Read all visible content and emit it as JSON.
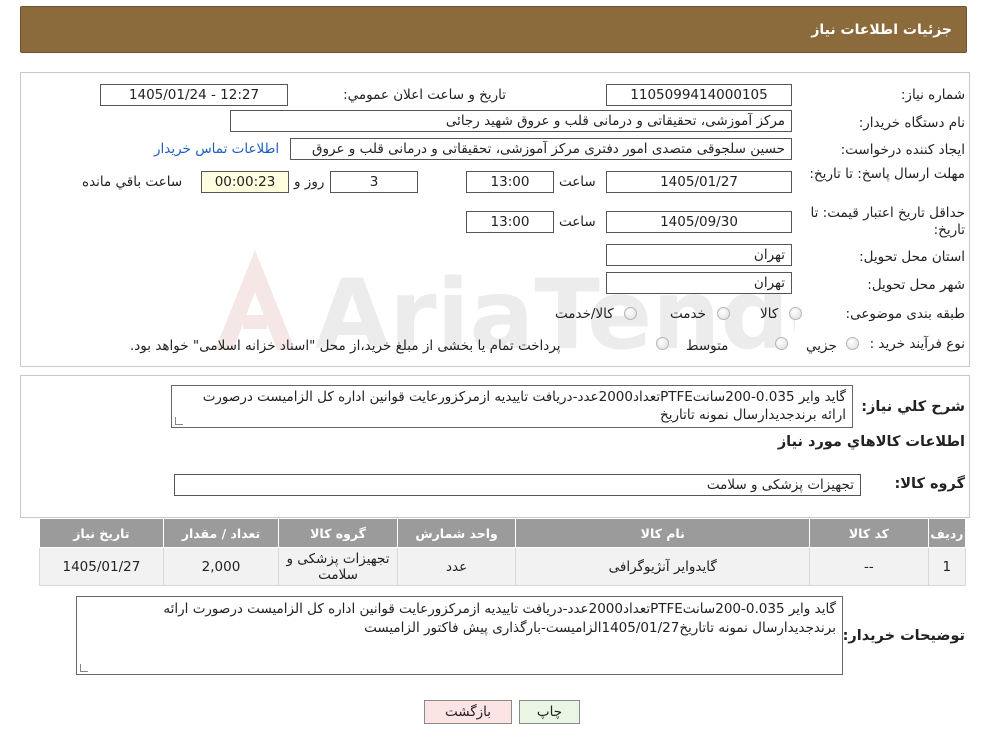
{
  "header": {
    "title": "جزئیات اطلاعات نیاز"
  },
  "info": {
    "need_number_label": "شماره نیاز:",
    "need_number": "1105099414000105",
    "announce_label": "تاریخ و ساعت اعلان عمومي:",
    "announce_value": "1405/01/24 - 12:27",
    "buyer_org_label": "نام دستگاه خريدار:",
    "buyer_org": "مرکز آموزشی، تحقیقاتی و درمانی قلب و عروق شهید رجائی",
    "creator_label": "ايجاد کننده درخواست:",
    "creator": "حسین سلجوقی متصدی امور دفتری مرکز آموزشی، تحقیقاتی و درمانی قلب و عروق",
    "contact_link": "اطلاعات تماس خريدار",
    "deadline_label": "مهلت ارسال پاسخ: تا تاريخ:",
    "deadline_date": "1405/01/27",
    "time_label": "ساعت",
    "deadline_time": "13:00",
    "days_count": "3",
    "days_label": "روز و",
    "remaining_time": "00:00:23",
    "remaining_label": "ساعت باقي مانده",
    "validity_label": "حداقل تاريخ اعتبار قيمت: تا تاريخ:",
    "validity_date": "1405/09/30",
    "validity_time": "13:00",
    "province_label": "استان محل تحويل:",
    "province": "تهران",
    "city_label": "شهر محل تحويل:",
    "city": "تهران",
    "category_label": "طبقه بندی موضوعی:",
    "category_options": [
      "کالا",
      "خدمت",
      "کالا/خدمت"
    ],
    "process_label": "نوع فرآيند خريد :",
    "process_options": [
      "جزيي",
      "متوسط"
    ],
    "process_note": "پرداخت تمام یا بخشی از مبلغ خرید،از محل \"اسناد خزانه اسلامی\" خواهد بود."
  },
  "description": {
    "label": "شرح کلي نياز:",
    "text": "گاید وایر 0.035-200سانتPTFEتعداد2000عدد-دریافت تاییدیه ازمرکزورعایت قوانین اداره کل الزامیست درصورت ارائه برندجدیدارسال نمونه تاتاریخ"
  },
  "goods": {
    "section_title": "اطلاعات کالاهاي مورد نياز",
    "group_label": "گروه کالا:",
    "group_value": "تجهیزات پزشکی و سلامت",
    "columns": [
      "رديف",
      "کد کالا",
      "نام کالا",
      "واحد شمارش",
      "گروه کالا",
      "تعداد / مقدار",
      "تاريخ نياز"
    ],
    "rows": [
      [
        "1",
        "--",
        "گایدوایر آنژیوگرافی",
        "عدد",
        "تجهیزات پزشکی و سلامت",
        "2,000",
        "1405/01/27"
      ]
    ]
  },
  "buyer_notes": {
    "label": "توضيحات خريدار:",
    "text": "گاید وایر 0.035-200سانتPTFEتعداد2000عدد-دریافت تاییدیه ازمرکزورعایت قوانین اداره کل الزامیست درصورت ارائه برندجدیدارسال نمونه تاتاریخ1405/01/27الزامیست-بارگذاری پیش فاکتور الزامیست"
  },
  "buttons": {
    "print": "چاپ",
    "back": "بازگشت"
  },
  "watermark": {
    "text": "AriaTender.neT"
  }
}
